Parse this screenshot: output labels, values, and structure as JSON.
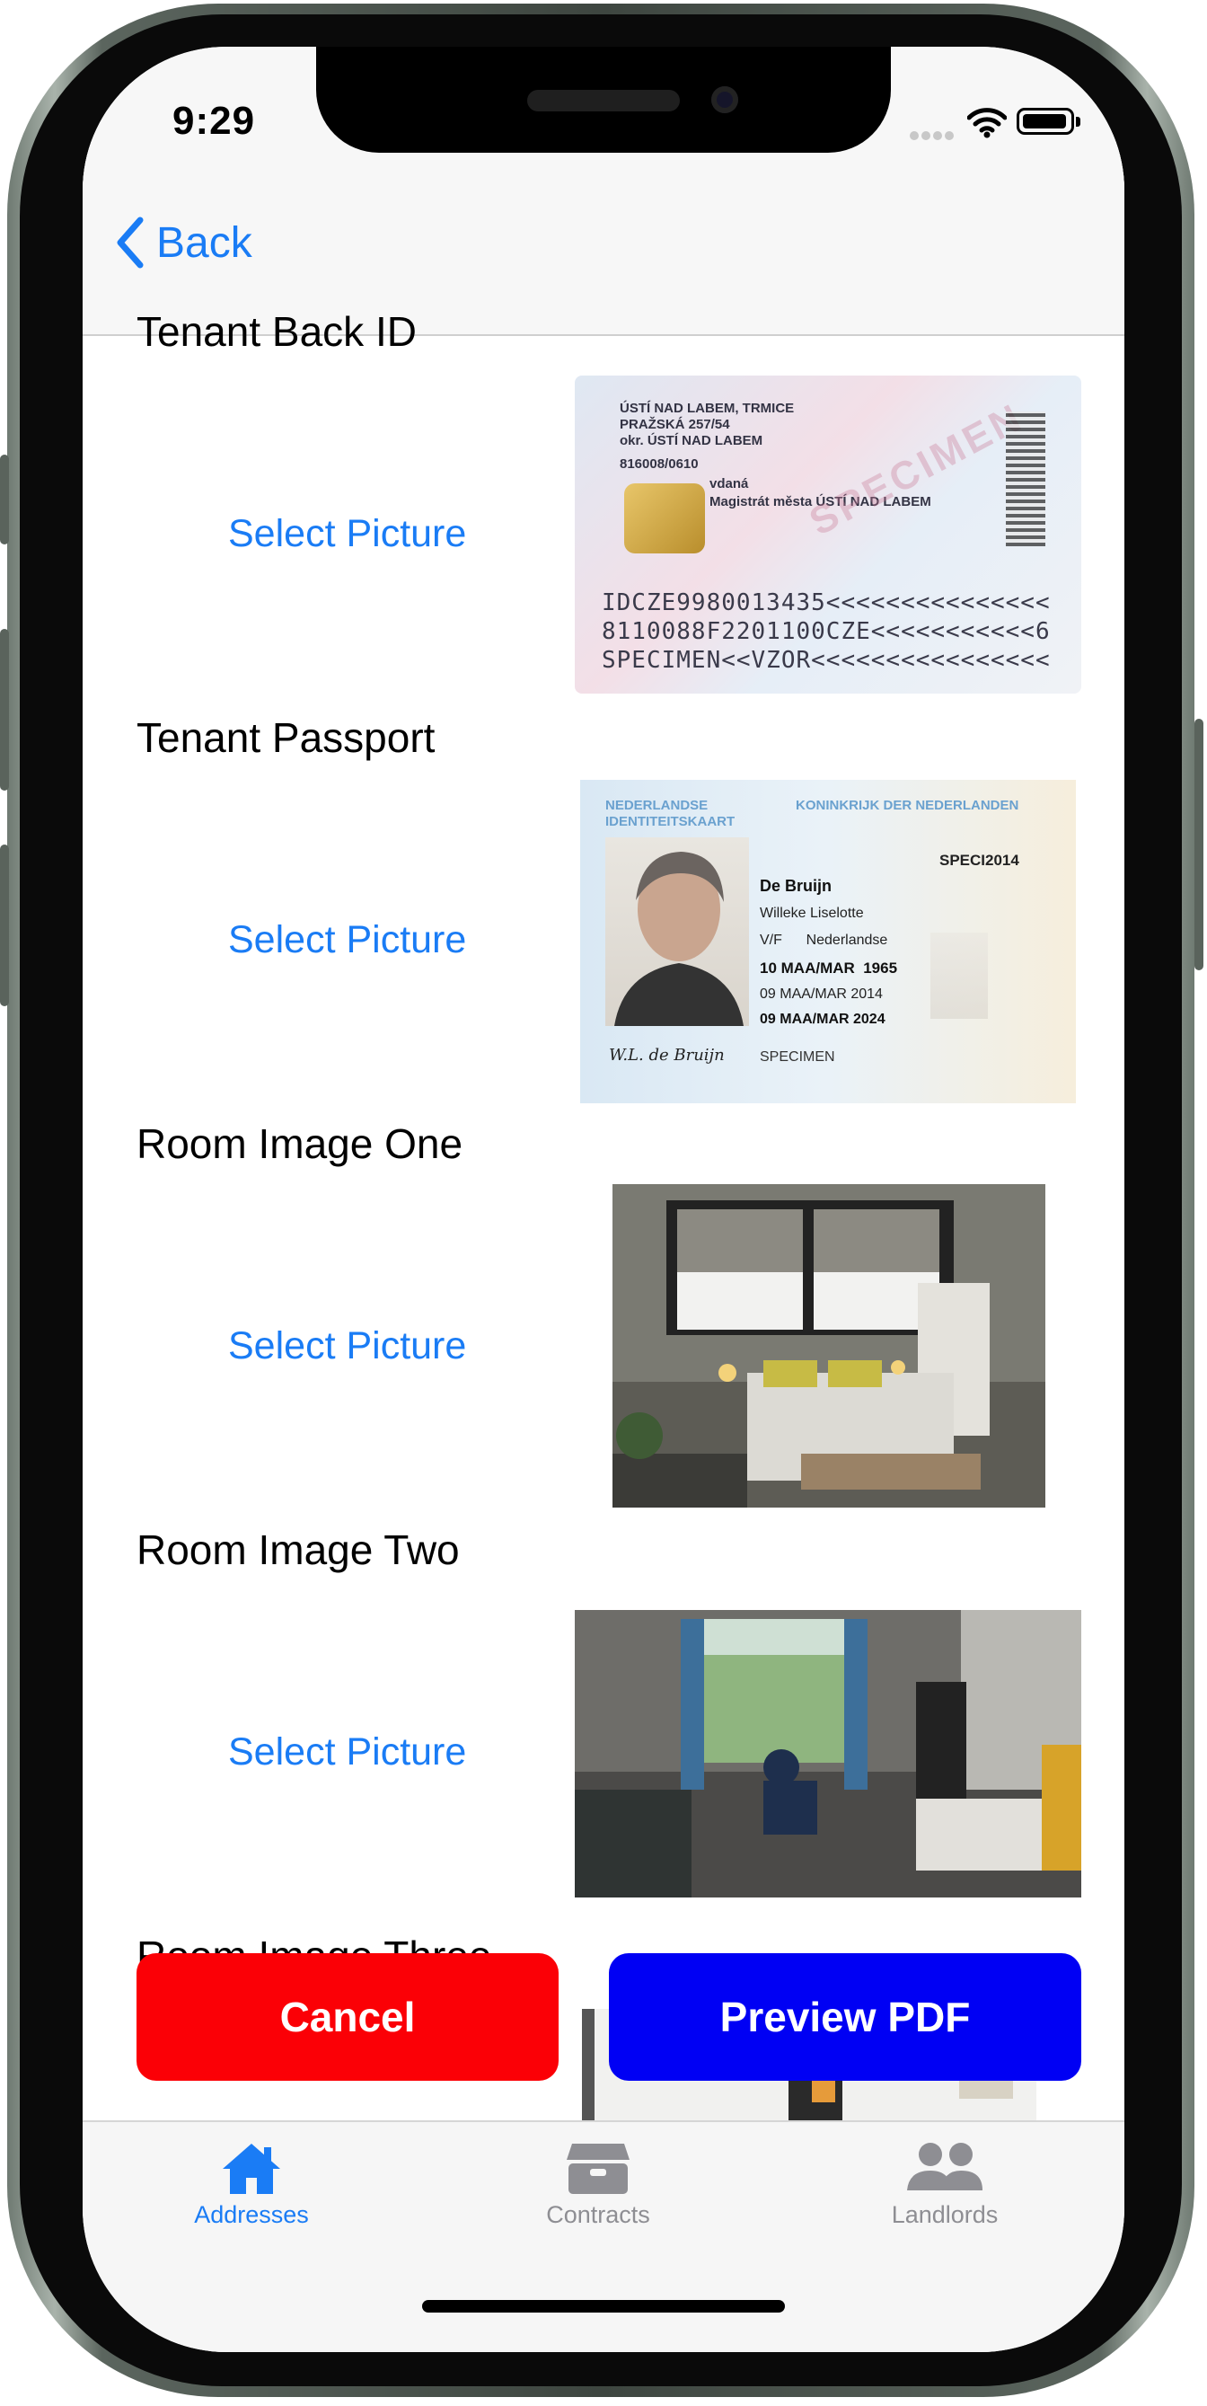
{
  "status_bar": {
    "time": "9:29"
  },
  "nav": {
    "back_label": "Back"
  },
  "sections": [
    {
      "title": "Tenant Back ID",
      "action": "Select Picture"
    },
    {
      "title": "Tenant Passport",
      "action": "Select Picture"
    },
    {
      "title": "Room Image One",
      "action": "Select Picture"
    },
    {
      "title": "Room Image Two",
      "action": "Select Picture"
    },
    {
      "title": "Room Image Three"
    }
  ],
  "id_back": {
    "line1": "ÚSTÍ NAD LABEM, TRMICE",
    "line2": "PRAŽSKÁ 257/54",
    "line3": "okr. ÚSTÍ NAD LABEM",
    "line4": "816008/0610",
    "line5": "vdaná",
    "line6": "Magistrát města ÚSTÍ NAD LABEM",
    "watermark": "SPECIMEN",
    "mrz1": "IDCZE9980013435<<<<<<<<<<<<<<<",
    "mrz2": "8110088F2201100CZE<<<<<<<<<<<6",
    "mrz3": "SPECIMEN<<VZOR<<<<<<<<<<<<<<<<"
  },
  "passport": {
    "header_left": "NEDERLANDSE IDENTITEITSKAART",
    "header_right": "KONINKRIJK DER NEDERLANDEN",
    "surname": "De Bruijn",
    "given": "Willeke Liselotte",
    "sex_nat": "V/F      Nederlandse",
    "dob": "10 MAA/MAR  1965",
    "issued": "09 MAA/MAR 2014",
    "expiry": "09 MAA/MAR 2024",
    "doc_no": "SPECI2014",
    "specimen": "SPECIMEN",
    "signature": "W.L. de Bruijn"
  },
  "buttons": {
    "cancel": "Cancel",
    "preview": "Preview PDF"
  },
  "tabs": [
    {
      "label": "Addresses",
      "icon": "house-icon",
      "active": true
    },
    {
      "label": "Contracts",
      "icon": "archive-box-icon",
      "active": false
    },
    {
      "label": "Landlords",
      "icon": "people-icon",
      "active": false
    }
  ],
  "colors": {
    "accent": "#1a7cf5",
    "cancel": "#fb0006",
    "preview": "#0000f4",
    "inactive_tab": "#8e8e93"
  }
}
